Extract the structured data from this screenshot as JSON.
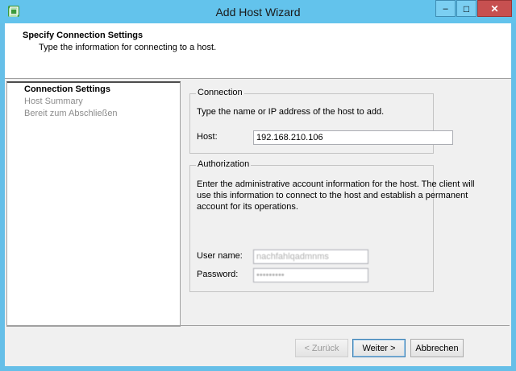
{
  "window": {
    "title": "Add Host Wizard",
    "minimize_glyph": "–",
    "maximize_glyph": "□",
    "close_glyph": "✕",
    "app_icon": "vmware-icon"
  },
  "header": {
    "title": "Specify Connection Settings",
    "subtitle": "Type the information for connecting to a host."
  },
  "steps": [
    {
      "label": "Connection Settings",
      "active": true
    },
    {
      "label": "Host Summary",
      "active": false
    },
    {
      "label": "Bereit zum Abschließen",
      "active": false
    }
  ],
  "connection": {
    "legend": "Connection",
    "instructions": "Type the name or IP address of the host to add.",
    "host_label": "Host:",
    "host_value": "192.168.210.106"
  },
  "authorization": {
    "legend": "Authorization",
    "instructions": "Enter the administrative account information for the host. The client will use this information to connect to the host and establish a permanent account for its operations.",
    "username_label": "User name:",
    "username_value": "nachfahlqadmnms",
    "password_label": "Password:",
    "password_value": "•••••••••"
  },
  "buttons": {
    "back": "< Zurück",
    "next": "Weiter >",
    "cancel": "Abbrechen"
  },
  "colors": {
    "titlebar": "#63c3ec",
    "close_button": "#c75050",
    "window_face": "#f0f0f0"
  }
}
